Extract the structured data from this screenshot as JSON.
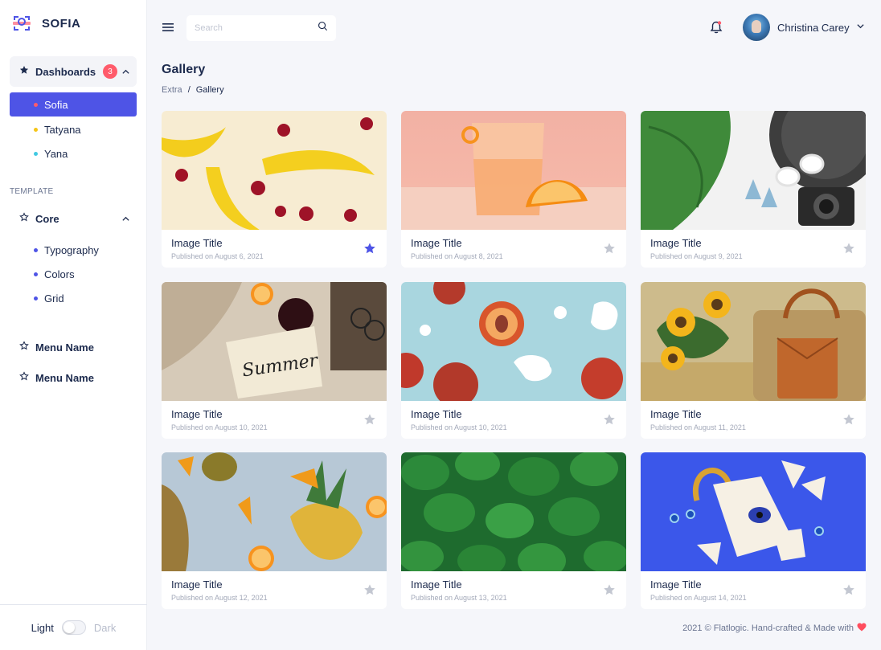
{
  "app": {
    "name": "SOFIA"
  },
  "sidebar": {
    "dashboards": {
      "label": "Dashboards",
      "badge": "3"
    },
    "dashboard_items": [
      {
        "label": "Sofia",
        "dot": "#ff5b6b"
      },
      {
        "label": "Tatyana",
        "dot": "#f5c518"
      },
      {
        "label": "Yana",
        "dot": "#41c9e2"
      }
    ],
    "section_label": "TEMPLATE",
    "core": {
      "label": "Core"
    },
    "core_items": [
      {
        "label": "Typography",
        "dot": "#4e54e6"
      },
      {
        "label": "Colors",
        "dot": "#4e54e6"
      },
      {
        "label": "Grid",
        "dot": "#4e54e6"
      }
    ],
    "menu_items": [
      "Menu Name",
      "Menu Name"
    ],
    "theme": {
      "light": "Light",
      "dark": "Dark"
    }
  },
  "header": {
    "search_placeholder": "Search",
    "user_name": "Christina Carey"
  },
  "page": {
    "title": "Gallery",
    "breadcrumb": [
      "Extra",
      "Gallery"
    ]
  },
  "gallery": [
    {
      "title": "Image Title",
      "date": "Published on August 6, 2021",
      "starred": true,
      "image": "bananas-cherries"
    },
    {
      "title": "Image Title",
      "date": "Published on August 8, 2021",
      "starred": false,
      "image": "juice-orange"
    },
    {
      "title": "Image Title",
      "date": "Published on August 9, 2021",
      "starred": false,
      "image": "leaf-hat-camera"
    },
    {
      "title": "Image Title",
      "date": "Published on August 10, 2021",
      "starred": false,
      "image": "summer-note"
    },
    {
      "title": "Image Title",
      "date": "Published on August 10, 2021",
      "starred": false,
      "image": "peaches"
    },
    {
      "title": "Image Title",
      "date": "Published on August 11, 2021",
      "starred": false,
      "image": "sunflowers-bag"
    },
    {
      "title": "Image Title",
      "date": "Published on August 12, 2021",
      "starred": false,
      "image": "pineapple-mango"
    },
    {
      "title": "Image Title",
      "date": "Published on August 13, 2021",
      "starred": false,
      "image": "green-leaves"
    },
    {
      "title": "Image Title",
      "date": "Published on August 14, 2021",
      "starred": false,
      "image": "broken-cup"
    }
  ],
  "footer": {
    "text": "2021 © Flatlogic. Hand-crafted & Made with"
  },
  "colors": {
    "accent": "#4e54e6",
    "badge": "#ff5b6b",
    "star_active": "#4e54e6",
    "star_inactive": "#c3c7d1",
    "heart": "#ff4d5e"
  }
}
